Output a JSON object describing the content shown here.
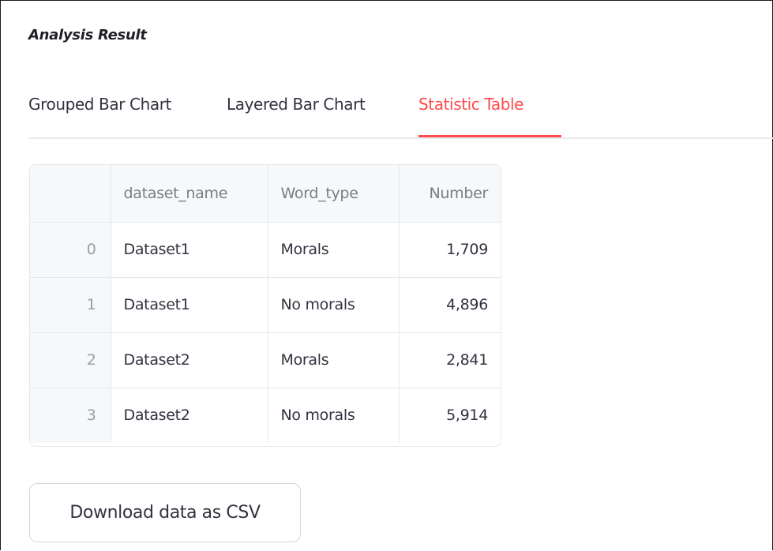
{
  "section": {
    "title": "Analysis Result"
  },
  "tabs": [
    {
      "label": "Grouped Bar Chart",
      "active": false
    },
    {
      "label": "Layered Bar Chart",
      "active": false
    },
    {
      "label": "Statistic Table",
      "active": true
    }
  ],
  "colors": {
    "accent": "#ff4b4b",
    "text": "#31333f",
    "header_bg": "#f7f8fa"
  },
  "table": {
    "columns": [
      "",
      "dataset_name",
      "Word_type",
      "Number"
    ],
    "rows": [
      {
        "index": "0",
        "dataset_name": "Dataset1",
        "word_type": "Morals",
        "number": "1,709"
      },
      {
        "index": "1",
        "dataset_name": "Dataset1",
        "word_type": "No morals",
        "number": "4,896"
      },
      {
        "index": "2",
        "dataset_name": "Dataset2",
        "word_type": "Morals",
        "number": "2,841"
      },
      {
        "index": "3",
        "dataset_name": "Dataset2",
        "word_type": "No morals",
        "number": "5,914"
      }
    ]
  },
  "download": {
    "label": "Download data as CSV"
  }
}
